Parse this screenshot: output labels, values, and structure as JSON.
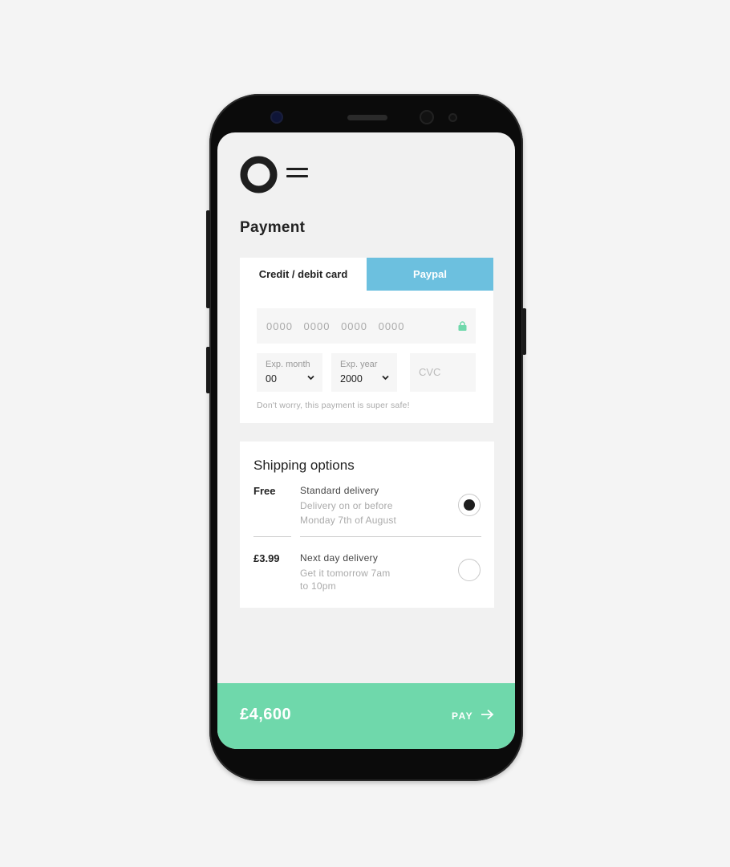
{
  "header": {
    "logo_icon": "ring-logo-icon",
    "menu_icon": "hamburger-menu-icon",
    "title": "Payment"
  },
  "payment": {
    "tabs": [
      {
        "label": "Credit / debit card",
        "active": true
      },
      {
        "label": "Paypal",
        "active": false,
        "color": "#6cc0df"
      }
    ],
    "card_number_placeholder": "0000 0000 0000 0000",
    "lock_icon": "lock-icon",
    "lock_color": "#6fd8ab",
    "exp_month": {
      "label": "Exp. month",
      "value": "00"
    },
    "exp_year": {
      "label": "Exp. year",
      "value": "2000"
    },
    "cvc_placeholder": "CVC",
    "note": "Don't worry, this payment is super safe!"
  },
  "shipping": {
    "title": "Shipping options",
    "options": [
      {
        "price": "Free",
        "name": "Standard delivery",
        "desc_lines": [
          "Delivery on or before",
          "Monday 7th of August"
        ],
        "selected": true
      },
      {
        "price": "£3.99",
        "name": "Next day delivery",
        "desc_lines": [
          "Get it tomorrow 7am",
          "to 10pm"
        ],
        "selected": false
      }
    ]
  },
  "footer": {
    "total": "£4,600",
    "pay_label": "PAY",
    "arrow_icon": "arrow-right-icon",
    "color": "#6fd8ab"
  }
}
